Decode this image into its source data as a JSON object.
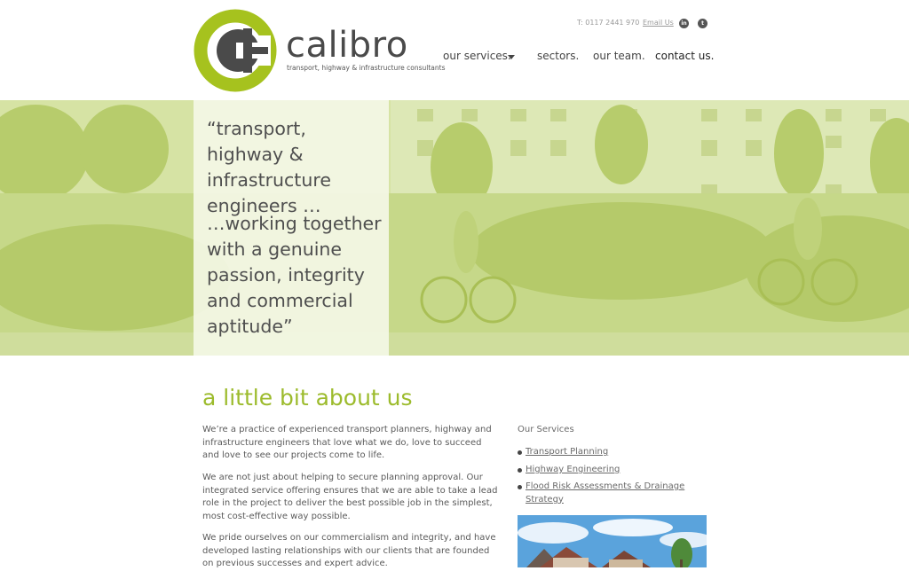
{
  "brand": {
    "name": "calibro",
    "tagline": "transport, highway & infrastructure consultants",
    "colors": {
      "accent_green": "#a6c21e",
      "dark_grey": "#4a4a4a"
    }
  },
  "header": {
    "phone": "T: 0117 2441 970",
    "email_label": "Email Us",
    "social": [
      {
        "icon": "linkedin-icon",
        "glyph": "in"
      },
      {
        "icon": "twitter-icon",
        "glyph": "t"
      }
    ],
    "nav": {
      "services": "our services.",
      "sectors": "sectors.",
      "team": "our team.",
      "contact": "contact us."
    }
  },
  "hero": {
    "quote_part1": "“transport, highway & infrastructure engineers …",
    "quote_part2": "…working together with a genuine passion, integrity and commercial aptitude”"
  },
  "about": {
    "title": "a little bit about us",
    "paragraphs": [
      "We’re a practice of experienced transport planners, highway and infrastructure engineers that love what we do, love to succeed and love to see our projects come to life.",
      "We are not just about helping to secure planning approval. Our integrated service offering ensures that we are able to take a lead role in the project to deliver the best possible job in the simplest, most cost-effective way possible.",
      "We pride ourselves on our commercialism and integrity, and have developed lasting relationships with our clients that are founded on previous successes and expert advice."
    ]
  },
  "services": {
    "heading": "Our Services",
    "items": [
      "Transport Planning",
      "Highway Engineering",
      "Flood Risk Assessments & Drainage Strategy"
    ]
  }
}
